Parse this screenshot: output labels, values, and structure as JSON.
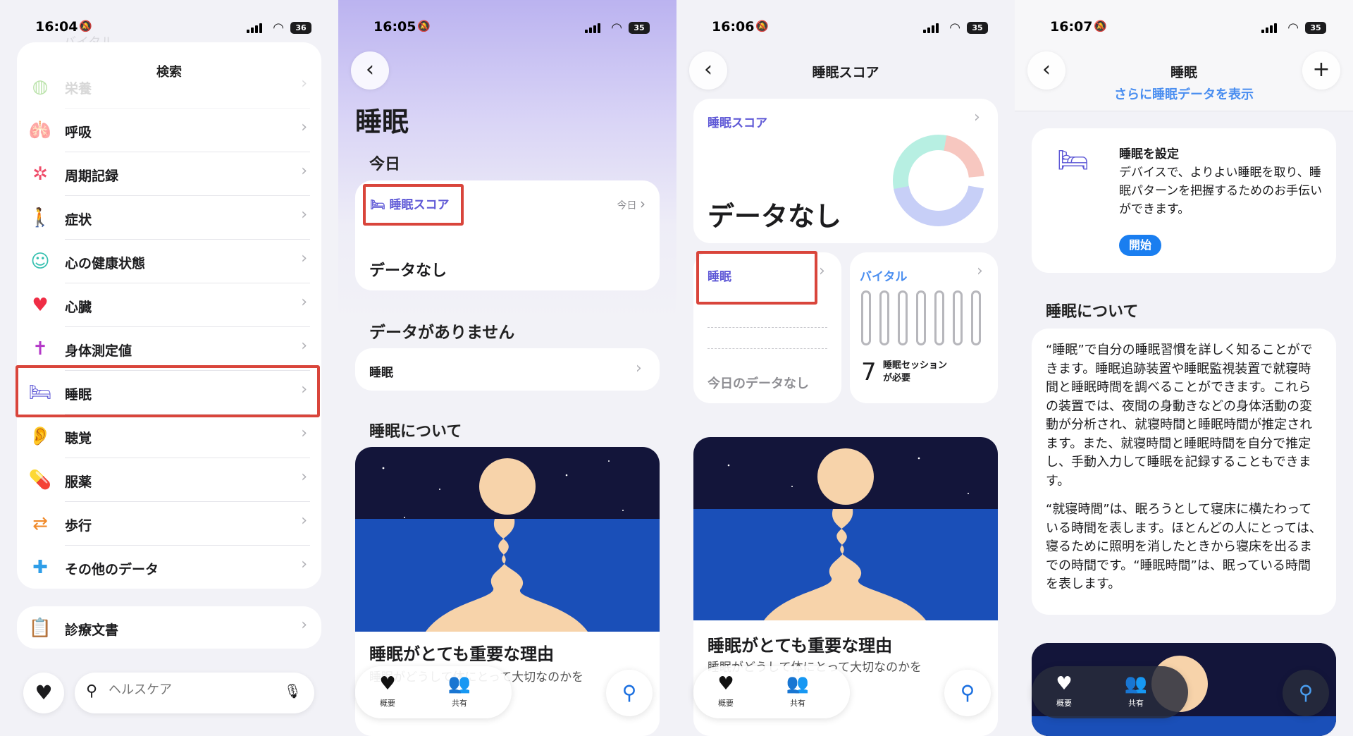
{
  "status_bar": [
    {
      "time": "16:04",
      "battery": "36"
    },
    {
      "time": "16:05",
      "battery": "35"
    },
    {
      "time": "16:06",
      "battery": "35"
    },
    {
      "time": "16:07",
      "battery": "35"
    }
  ],
  "panel1": {
    "title": "検索",
    "ghost_items": [
      "バイタル",
      "栄養"
    ],
    "items": [
      {
        "label": "呼吸",
        "icon": "lungs-icon"
      },
      {
        "label": "周期記録",
        "icon": "cycle-icon"
      },
      {
        "label": "症状",
        "icon": "symptom-icon"
      },
      {
        "label": "心の健康状態",
        "icon": "mind-icon"
      },
      {
        "label": "心臓",
        "icon": "heart-icon"
      },
      {
        "label": "身体測定値",
        "icon": "body-icon"
      },
      {
        "label": "睡眠",
        "icon": "bed-icon"
      },
      {
        "label": "聴覚",
        "icon": "ear-icon"
      },
      {
        "label": "服薬",
        "icon": "pills-icon"
      },
      {
        "label": "歩行",
        "icon": "walking-icon"
      },
      {
        "label": "その他のデータ",
        "icon": "plus-icon"
      }
    ],
    "records_label": "診療文書",
    "search_placeholder": "ヘルスケア"
  },
  "panel2": {
    "title": "睡眠",
    "today_header": "今日",
    "score_tag": "睡眠スコア",
    "score_date": "今日",
    "no_data": "データなし",
    "no_data_header": "データがありません",
    "sleep_row": "睡眠",
    "about_header": "睡眠について",
    "article_title": "睡眠がとても重要な理由",
    "article_sub": "睡眠がどうして体にとって大切なのかを"
  },
  "panel3": {
    "title": "睡眠スコア",
    "score_tag": "睡眠スコア",
    "no_data": "データなし",
    "sleep_tag": "睡眠",
    "today_no_data": "今日のデータなし",
    "vitals_tag": "バイタル",
    "sessions_num": "7",
    "sessions_text": "睡眠セッション\nが必要",
    "article_title": "睡眠がとても重要な理由",
    "article_sub": "睡眠がどうして体にとって大切なのかを"
  },
  "panel4": {
    "title": "睡眠",
    "more_link": "さらに睡眠データを表示",
    "setup_title": "睡眠を設定",
    "setup_body": "デバイスで、よりよい睡眠を取り、睡眠パターンを把握するためのお手伝いができます。",
    "start_btn": "開始",
    "about_header": "睡眠について",
    "para1": "“睡眠”で自分の睡眠習慣を詳しく知ることができます。睡眠追跡装置や睡眠監視装置で就寝時間と睡眠時間を調べることができます。これらの装置では、夜間の身動きなどの身体活動の変動が分析され、就寝時間と睡眠時間が推定されます。また、就寝時間と睡眠時間を自分で推定し、手動入力して睡眠を記録することもできます。",
    "para2": "“就寝時間”は、眠ろうとして寝床に横たわっている時間を表します。ほとんどの人にとっては、寝るために照明を消したときから寝床を出るまでの時間です。“睡眠時間”は、眠っている時間を表します。"
  },
  "tabbar": {
    "summary": "概要",
    "sharing": "共有"
  },
  "colors": {
    "accent": "#5e58d6",
    "highlight": "#d9453b",
    "link": "#1a7ef0"
  }
}
